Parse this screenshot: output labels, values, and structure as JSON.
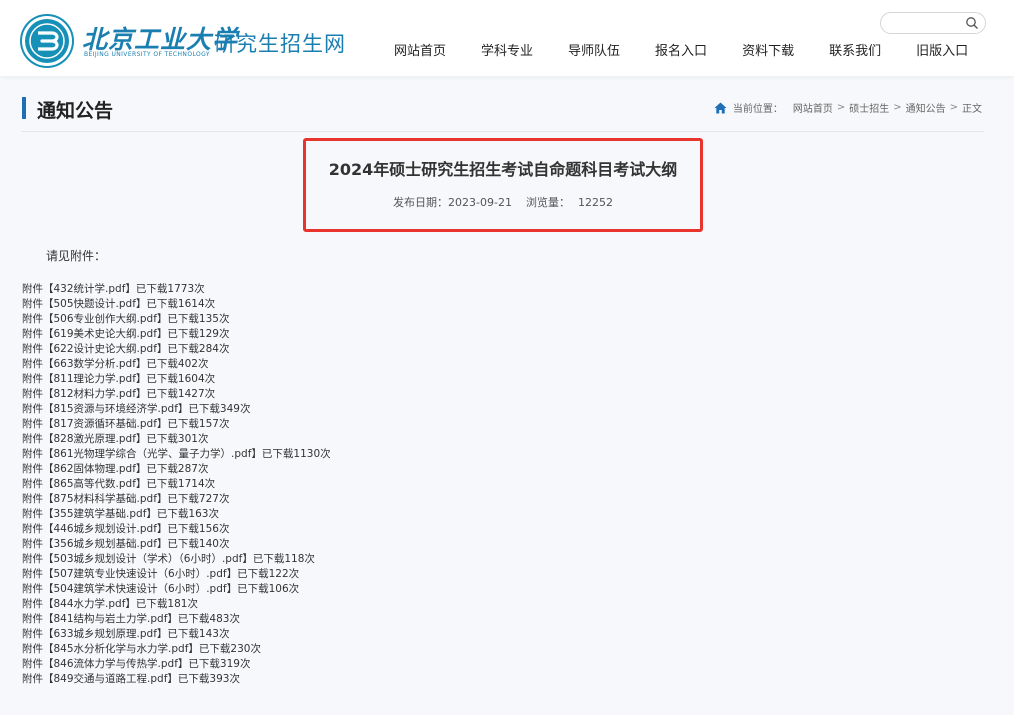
{
  "header": {
    "school_name": "北京工业大学",
    "school_name_en": "BEIJING UNIVERSITY OF TECHNOLOGY",
    "site_name": "研究生招生网",
    "search": {
      "placeholder": ""
    },
    "nav": [
      "网站首页",
      "学科专业",
      "导师队伍",
      "报名入口",
      "资料下载",
      "联系我们",
      "旧版入口"
    ]
  },
  "section": {
    "title": "通知公告",
    "breadcrumb_label": "当前位置：",
    "breadcrumb": [
      "网站首页",
      "硕士招生",
      "通知公告",
      "正文"
    ]
  },
  "article": {
    "title": "2024年硕士研究生招生考试自命题科目考试大纲",
    "date_label": "发布日期：",
    "date": "2023-09-21",
    "views_label": "浏览量：",
    "views": "12252",
    "intro": "请见附件：",
    "attachments": [
      "附件【432统计学.pdf】已下载1773次",
      "附件【505快题设计.pdf】已下载1614次",
      "附件【506专业创作大纲.pdf】已下载135次",
      "附件【619美术史论大纲.pdf】已下载129次",
      "附件【622设计史论大纲.pdf】已下载284次",
      "附件【663数学分析.pdf】已下载402次",
      "附件【811理论力学.pdf】已下载1604次",
      "附件【812材料力学.pdf】已下载1427次",
      "附件【815资源与环境经济学.pdf】已下载349次",
      "附件【817资源循环基础.pdf】已下载157次",
      "附件【828激光原理.pdf】已下载301次",
      "附件【861光物理学综合（光学、量子力学）.pdf】已下载1130次",
      "附件【862固体物理.pdf】已下载287次",
      "附件【865高等代数.pdf】已下载1714次",
      "附件【875材料科学基础.pdf】已下载727次",
      "附件【355建筑学基础.pdf】已下载163次",
      "附件【446城乡规划设计.pdf】已下载156次",
      "附件【356城乡规划基础.pdf】已下载140次",
      "附件【503城乡规划设计（学术）（6小时）.pdf】已下载118次",
      "附件【507建筑专业快速设计（6小时）.pdf】已下载122次",
      "附件【504建筑学术快速设计（6小时）.pdf】已下载106次",
      "附件【844水力学.pdf】已下载181次",
      "附件【841结构与岩土力学.pdf】已下载483次",
      "附件【633城乡规划原理.pdf】已下载143次",
      "附件【845水分析化学与水力学.pdf】已下载230次",
      "附件【846流体力学与传热学.pdf】已下载319次",
      "附件【849交通与道路工程.pdf】已下载393次"
    ]
  },
  "colors": {
    "brand": "#1a7fb0",
    "highlight": "#e8342d",
    "accent_bar": "#1e6fb5"
  }
}
